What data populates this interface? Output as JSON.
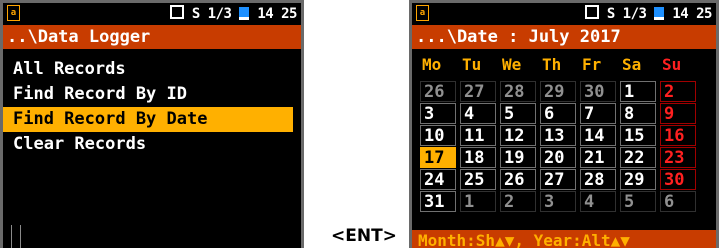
{
  "left_screen": {
    "status": {
      "page": "S 1/3",
      "time": "14 25"
    },
    "title": "..\\Data Logger",
    "menu": [
      "All Records",
      "Find Record By ID",
      "Find Record By Date",
      "Clear Records"
    ],
    "selected_index": 2
  },
  "key_label": "<ENT>",
  "right_screen": {
    "status": {
      "page": "S 1/3",
      "time": "14 25"
    },
    "title": "...\\Date : July 2017",
    "weekdays": [
      "Mo",
      "Tu",
      "We",
      "Th",
      "Fr",
      "Sa",
      "Su"
    ],
    "weeks": [
      [
        "26",
        "27",
        "28",
        "29",
        "30",
        "1",
        "2"
      ],
      [
        "3",
        "4",
        "5",
        "6",
        "7",
        "8",
        "9"
      ],
      [
        "10",
        "11",
        "12",
        "13",
        "14",
        "15",
        "16"
      ],
      [
        "17",
        "18",
        "19",
        "20",
        "21",
        "22",
        "23"
      ],
      [
        "24",
        "25",
        "26",
        "27",
        "28",
        "29",
        "30"
      ],
      [
        "31",
        "1",
        "2",
        "3",
        "4",
        "5",
        "6"
      ]
    ],
    "selected_day": "17",
    "footer": "Month:Sh▲▼, Year:Alt▲▼"
  },
  "colors": {
    "title_bar": "#c83c00",
    "highlight": "#ffb000",
    "sunday": "#ff2020",
    "background": "#000000"
  }
}
